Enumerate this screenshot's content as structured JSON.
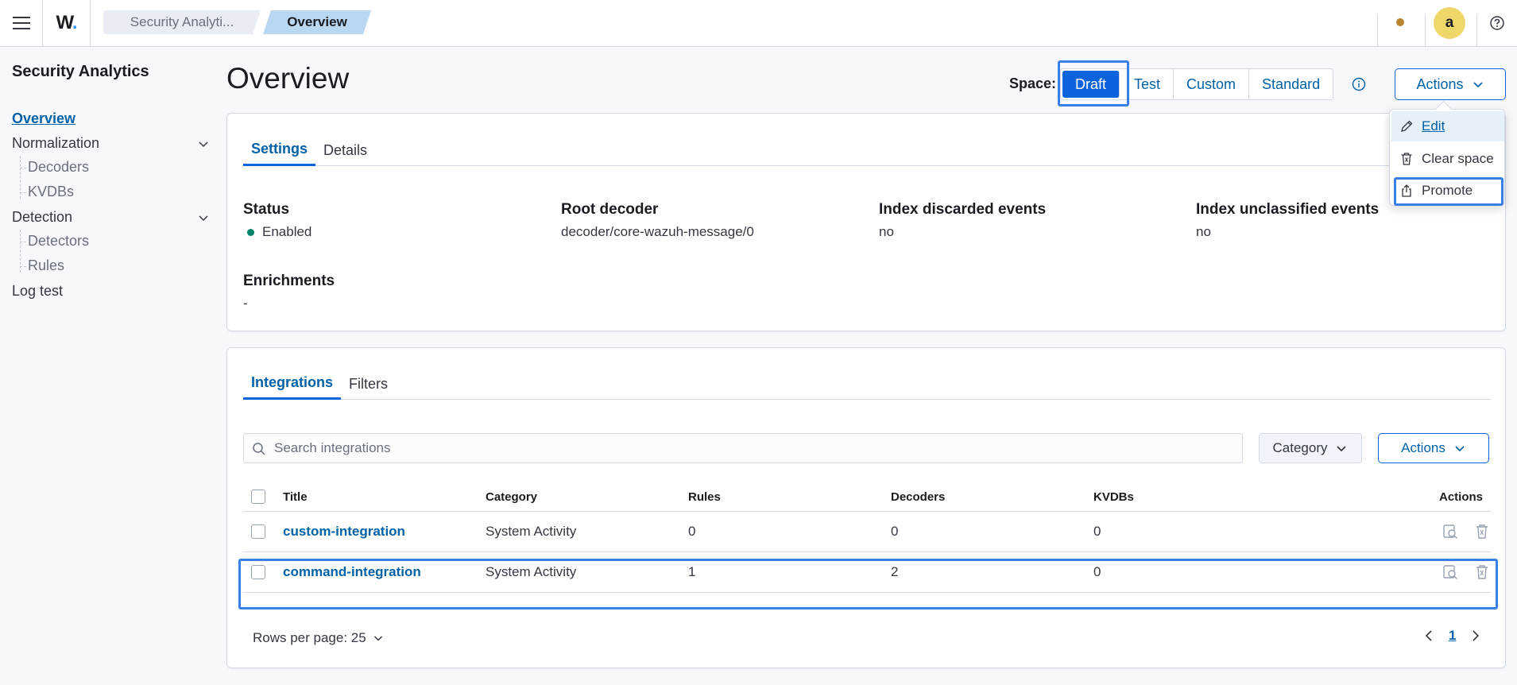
{
  "header": {
    "logo_text": "W",
    "logo_dot": ".",
    "breadcrumbs": [
      "Security Analyti...",
      "Overview"
    ],
    "avatar_initial": "a"
  },
  "sidebar": {
    "title": "Security Analytics",
    "items": [
      {
        "label": "Overview"
      },
      {
        "label": "Normalization",
        "children": [
          "Decoders",
          "KVDBs"
        ]
      },
      {
        "label": "Detection",
        "children": [
          "Detectors",
          "Rules"
        ]
      },
      {
        "label": "Log test"
      }
    ]
  },
  "page": {
    "title": "Overview",
    "space_label": "Space:",
    "spaces": [
      "Draft",
      "Test",
      "Custom",
      "Standard"
    ],
    "selected_space": "Draft",
    "actions_label": "Actions"
  },
  "actions_menu": {
    "items": [
      "Edit",
      "Clear space",
      "Promote"
    ]
  },
  "settings_panel": {
    "tabs": [
      "Settings",
      "Details"
    ],
    "fields": [
      {
        "label": "Status",
        "value": "Enabled"
      },
      {
        "label": "Root decoder",
        "value": "decoder/core-wazuh-message/0"
      },
      {
        "label": "Index discarded events",
        "value": "no"
      },
      {
        "label": "Index unclassified events",
        "value": "no"
      },
      {
        "label": "Enrichments",
        "value": "-"
      }
    ]
  },
  "integrations_panel": {
    "tabs": [
      "Integrations",
      "Filters"
    ],
    "search_placeholder": "Search integrations",
    "category_label": "Category",
    "actions_label": "Actions",
    "columns": [
      "Title",
      "Category",
      "Rules",
      "Decoders",
      "KVDBs",
      "Actions"
    ],
    "rows": [
      {
        "title": "custom-integration",
        "category": "System Activity",
        "rules": "0",
        "decoders": "0",
        "kvdbs": "0"
      },
      {
        "title": "command-integration",
        "category": "System Activity",
        "rules": "1",
        "decoders": "2",
        "kvdbs": "0"
      }
    ],
    "rows_per_page": "Rows per page: 25",
    "current_page": "1"
  },
  "colors": {
    "accent": "#0b64dd",
    "link": "#0061a6",
    "highlight": "#3a7fe8",
    "enabled": "#00866b"
  }
}
